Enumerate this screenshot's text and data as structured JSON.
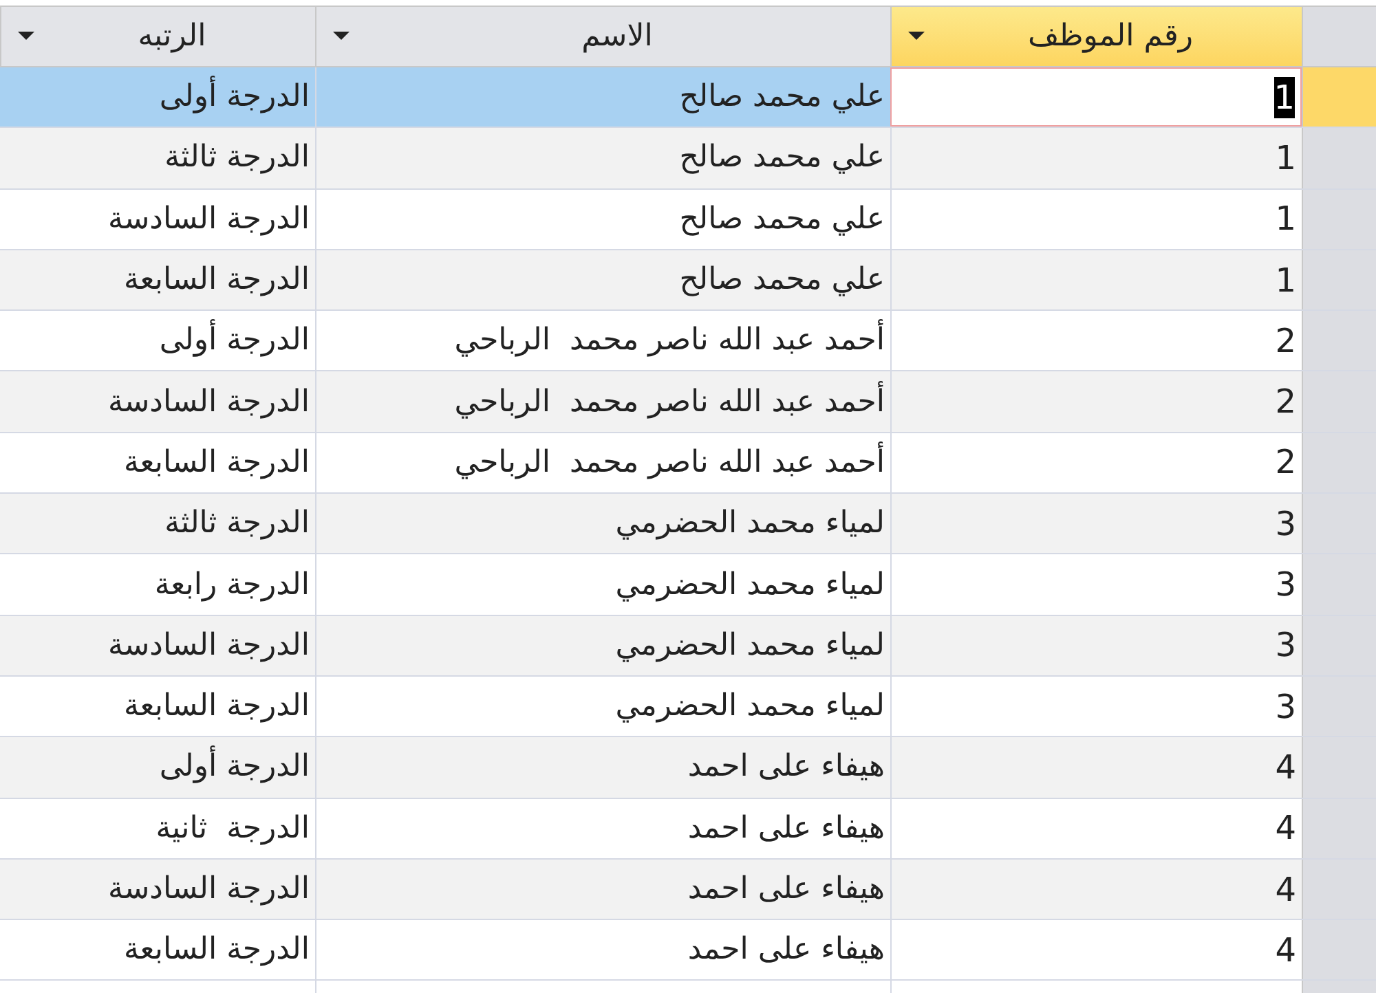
{
  "columns": [
    {
      "label": "رقم الموظف",
      "selected": true
    },
    {
      "label": "الاسم",
      "selected": false
    },
    {
      "label": "الرتبه",
      "selected": false
    }
  ],
  "rows": [
    {
      "id": "1",
      "name": "علي محمد صالح",
      "rank": "الدرجة أولى",
      "selected": true
    },
    {
      "id": "1",
      "name": "علي محمد صالح",
      "rank": "الدرجة ثالثة",
      "selected": false
    },
    {
      "id": "1",
      "name": "علي محمد صالح",
      "rank": "الدرجة السادسة",
      "selected": false
    },
    {
      "id": "1",
      "name": "علي محمد صالح",
      "rank": "الدرجة السابعة",
      "selected": false
    },
    {
      "id": "2",
      "name": "أحمد عبد الله ناصر محمد  الرباحي",
      "rank": "الدرجة أولى",
      "selected": false
    },
    {
      "id": "2",
      "name": "أحمد عبد الله ناصر محمد  الرباحي",
      "rank": "الدرجة السادسة",
      "selected": false
    },
    {
      "id": "2",
      "name": "أحمد عبد الله ناصر محمد  الرباحي",
      "rank": "الدرجة السابعة",
      "selected": false
    },
    {
      "id": "3",
      "name": "لمياء محمد الحضرمي",
      "rank": "الدرجة ثالثة",
      "selected": false
    },
    {
      "id": "3",
      "name": "لمياء محمد الحضرمي",
      "rank": "الدرجة رابعة",
      "selected": false
    },
    {
      "id": "3",
      "name": "لمياء محمد الحضرمي",
      "rank": "الدرجة السادسة",
      "selected": false
    },
    {
      "id": "3",
      "name": "لمياء محمد الحضرمي",
      "rank": "الدرجة السابعة",
      "selected": false
    },
    {
      "id": "4",
      "name": "هيفاء على احمد",
      "rank": "الدرجة أولى",
      "selected": false
    },
    {
      "id": "4",
      "name": "هيفاء على احمد",
      "rank": "الدرجة  ثانية",
      "selected": false
    },
    {
      "id": "4",
      "name": "هيفاء على احمد",
      "rank": "الدرجة السادسة",
      "selected": false
    },
    {
      "id": "4",
      "name": "هيفاء على احمد",
      "rank": "الدرجة السابعة",
      "selected": false
    }
  ]
}
